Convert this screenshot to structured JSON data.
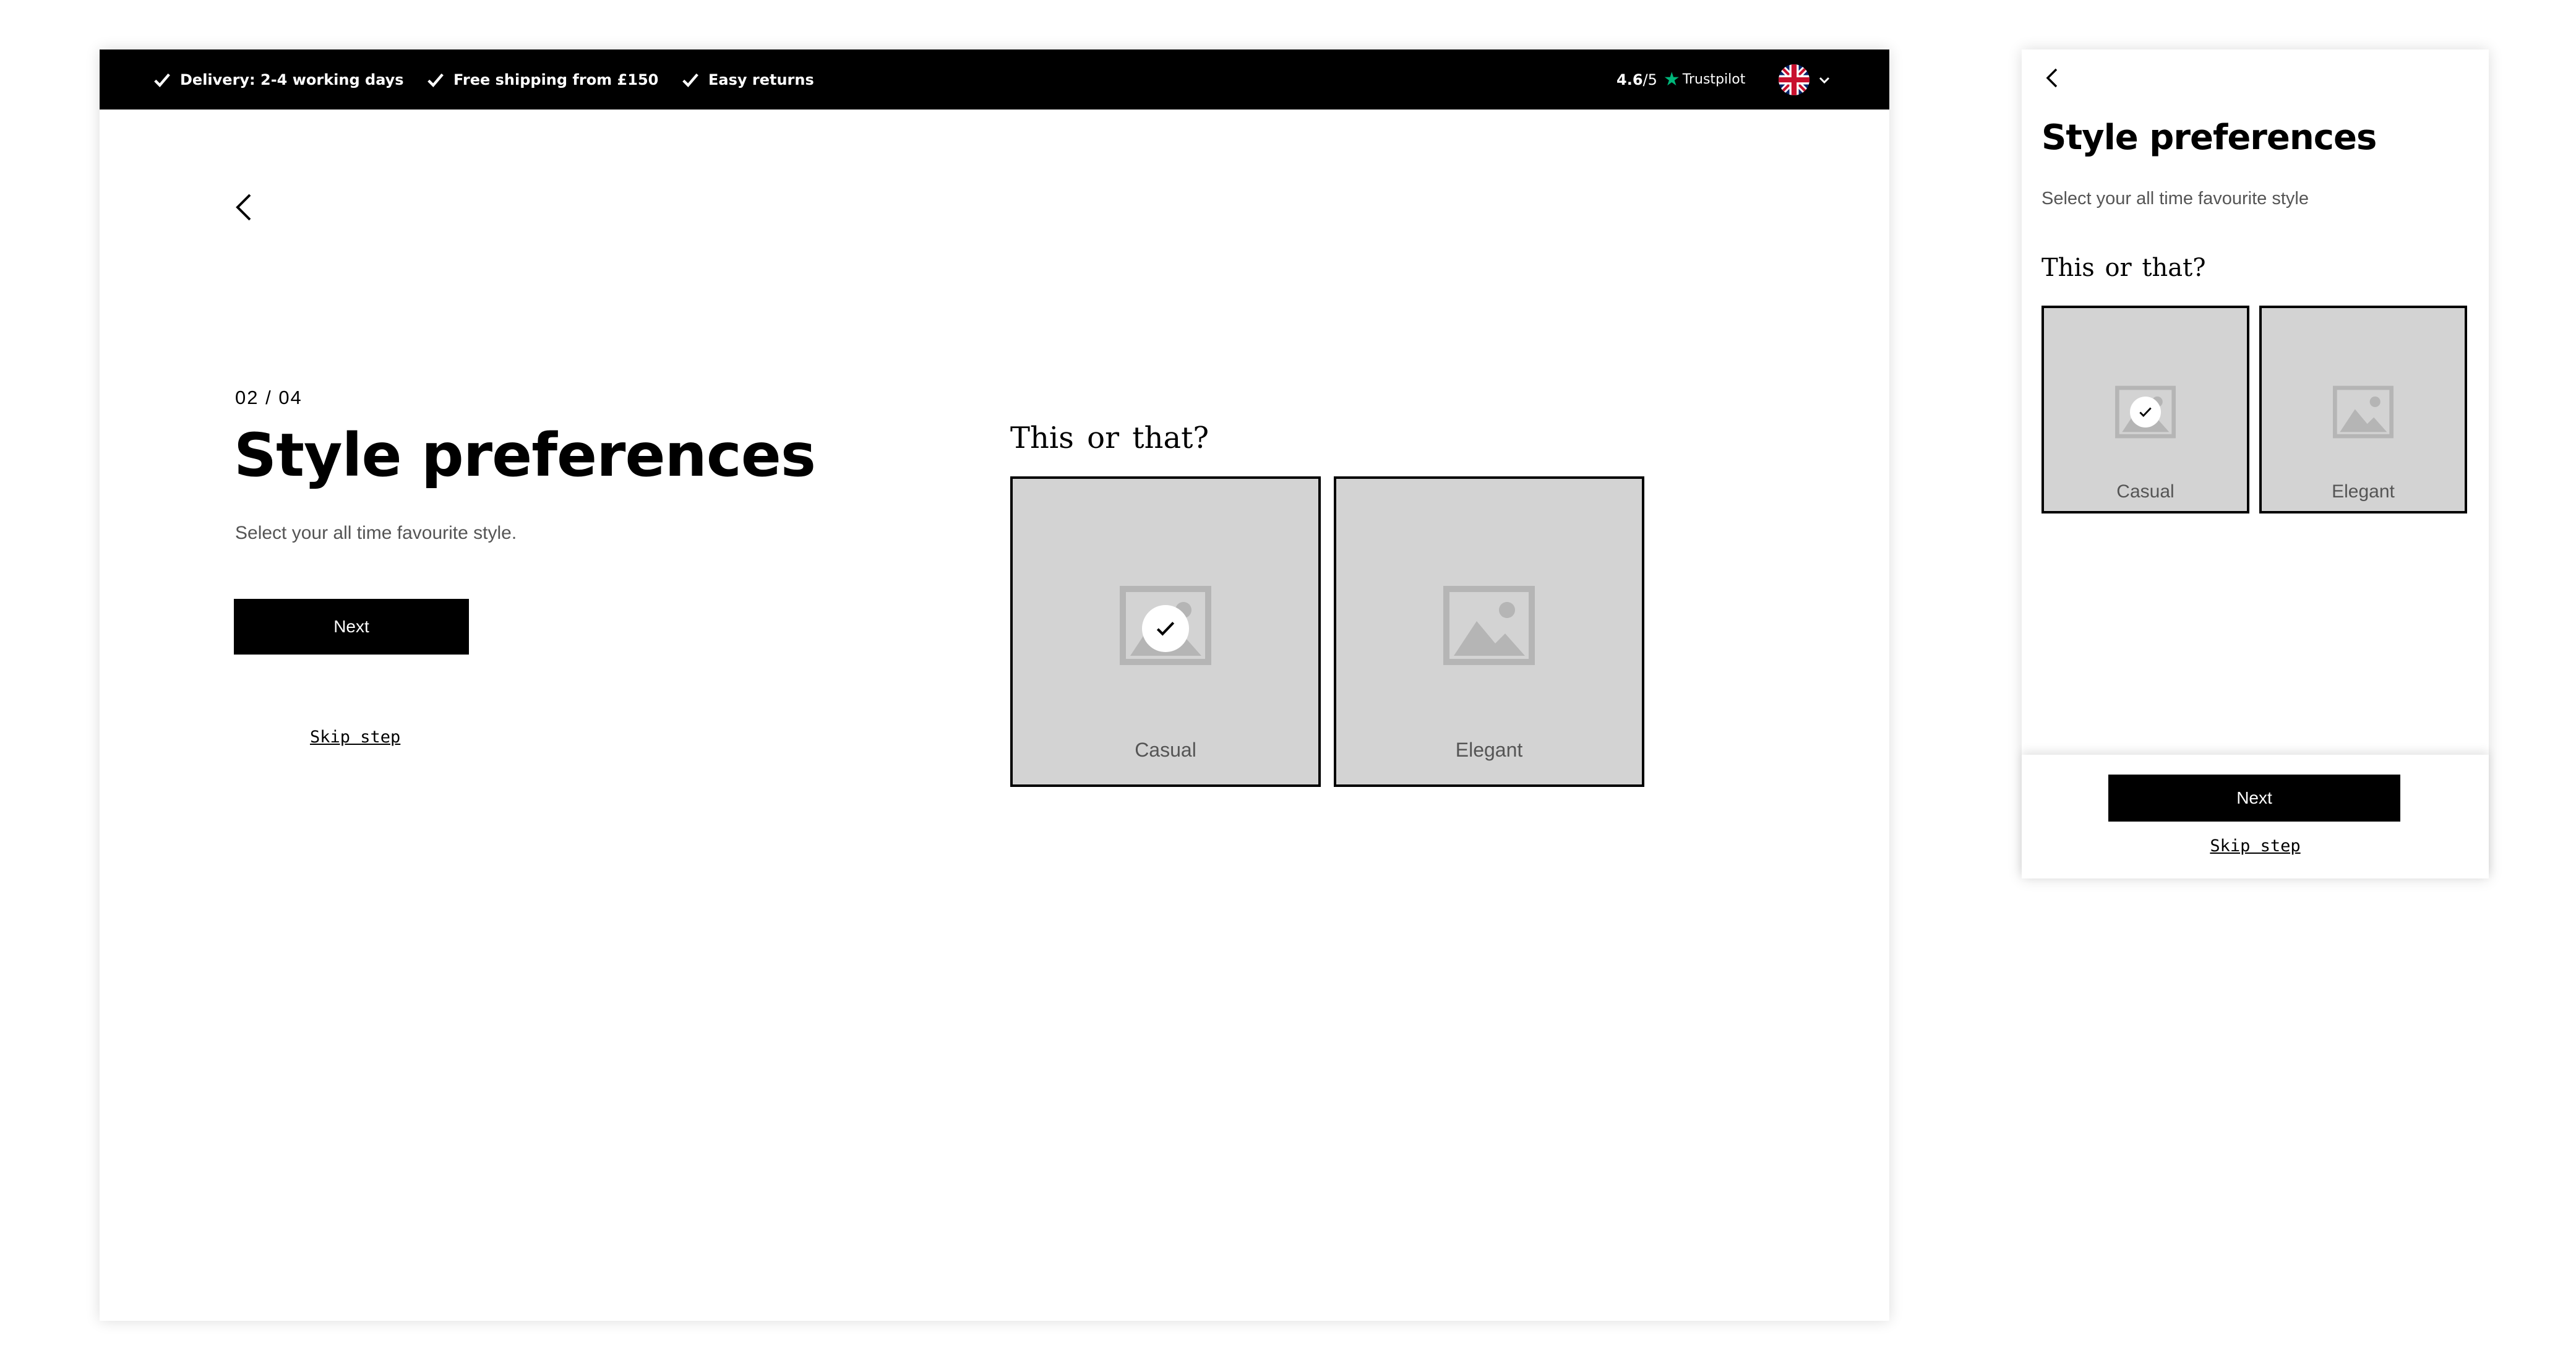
{
  "topbar": {
    "usps": [
      "Delivery: 2-4 working days",
      "Free shipping from £150",
      "Easy returns"
    ],
    "rating_score": "4.6",
    "rating_max": "/5",
    "rating_source": "Trustpilot",
    "language": "en-GB"
  },
  "desktop": {
    "step": "02 / 04",
    "title": "Style preferences",
    "subtitle": "Select your all time favourite style.",
    "next_label": "Next",
    "skip_label": "Skip step",
    "question": "This or that?",
    "options": [
      {
        "label": "Casual",
        "selected": true
      },
      {
        "label": "Elegant",
        "selected": false
      }
    ]
  },
  "mobile": {
    "title": "Style preferences",
    "subtitle": "Select your all time favourite style",
    "question": "This or that?",
    "options": [
      {
        "label": "Casual",
        "selected": true
      },
      {
        "label": "Elegant",
        "selected": false
      }
    ],
    "next_label": "Next",
    "skip_label": "Skip step"
  },
  "colors": {
    "topbar_bg": "#000000",
    "card_bg": "#d3d3d3",
    "placeholder_icon": "#b5b5b5",
    "trustpilot_star": "#00b67a"
  },
  "icons": [
    "check-icon",
    "star-icon",
    "uk-flag-icon",
    "chevron-down-icon",
    "back-arrow-icon",
    "image-placeholder-icon"
  ]
}
